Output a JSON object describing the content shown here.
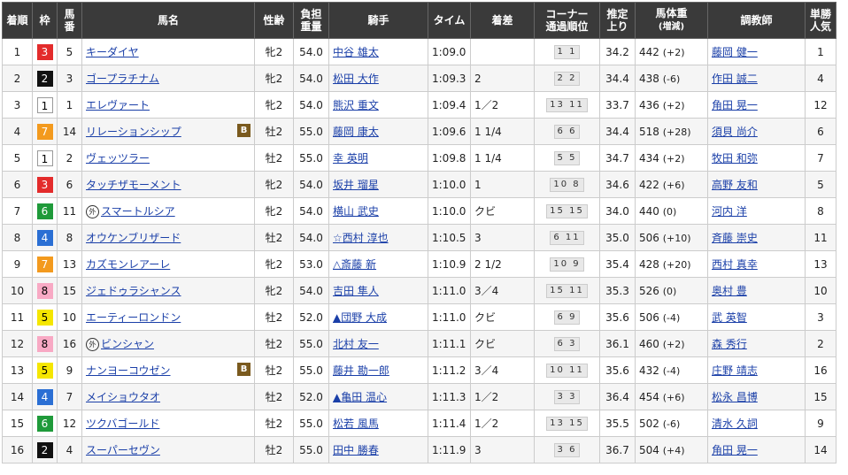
{
  "headers": {
    "rank": [
      "着順"
    ],
    "waku": [
      "枠"
    ],
    "num": [
      "馬",
      "番"
    ],
    "name": [
      "馬名"
    ],
    "sexage": [
      "性齢"
    ],
    "kinryo": [
      "負担",
      "重量"
    ],
    "jockey": [
      "騎手"
    ],
    "time": [
      "タイム"
    ],
    "margin": [
      "着差"
    ],
    "corner": [
      "コーナー",
      "通過順位"
    ],
    "agari": [
      "推定",
      "上り"
    ],
    "weight": [
      "馬体重",
      "(増減)"
    ],
    "trainer": [
      "調教師"
    ],
    "pop": [
      "単勝",
      "人気"
    ]
  },
  "rows": [
    {
      "rank": "1",
      "waku": "3",
      "num": "5",
      "name": "キーダイヤ",
      "gai": "",
      "blinker": "",
      "sex": "牝2",
      "kin": "54.0",
      "jockey": "中谷 雄太",
      "time": "1:09.0",
      "margin": "",
      "corner": "1 1",
      "agari": "34.2",
      "weight": "442",
      "diff": "(+2)",
      "trainer": "藤岡 健一",
      "pop": "1"
    },
    {
      "rank": "2",
      "waku": "2",
      "num": "3",
      "name": "ゴープラチナム",
      "gai": "",
      "blinker": "",
      "sex": "牝2",
      "kin": "54.0",
      "jockey": "松田 大作",
      "time": "1:09.3",
      "margin": "2",
      "corner": "2 2",
      "agari": "34.4",
      "weight": "438",
      "diff": "(-6)",
      "trainer": "作田 誠二",
      "pop": "4"
    },
    {
      "rank": "3",
      "waku": "1",
      "num": "1",
      "name": "エレヴァート",
      "gai": "",
      "blinker": "",
      "sex": "牝2",
      "kin": "54.0",
      "jockey": "熊沢 重文",
      "time": "1:09.4",
      "margin": "1／2",
      "corner": "13 11",
      "agari": "33.7",
      "weight": "436",
      "diff": "(+2)",
      "trainer": "角田 晃一",
      "pop": "12"
    },
    {
      "rank": "4",
      "waku": "7",
      "num": "14",
      "name": "リレーションシップ",
      "gai": "",
      "blinker": "B",
      "sex": "牡2",
      "kin": "55.0",
      "jockey": "藤岡 康太",
      "time": "1:09.6",
      "margin": "1 1/4",
      "corner": "6 6",
      "agari": "34.4",
      "weight": "518",
      "diff": "(+28)",
      "trainer": "須貝 尚介",
      "pop": "6"
    },
    {
      "rank": "5",
      "waku": "1",
      "num": "2",
      "name": "ヴェッツラー",
      "gai": "",
      "blinker": "",
      "sex": "牡2",
      "kin": "55.0",
      "jockey": "幸 英明",
      "time": "1:09.8",
      "margin": "1 1/4",
      "corner": "5 5",
      "agari": "34.7",
      "weight": "434",
      "diff": "(+2)",
      "trainer": "牧田 和弥",
      "pop": "7"
    },
    {
      "rank": "6",
      "waku": "3",
      "num": "6",
      "name": "タッチザモーメント",
      "gai": "",
      "blinker": "",
      "sex": "牝2",
      "kin": "54.0",
      "jockey": "坂井 瑠星",
      "time": "1:10.0",
      "margin": "1",
      "corner": "10 8",
      "agari": "34.6",
      "weight": "422",
      "diff": "(+6)",
      "trainer": "高野 友和",
      "pop": "5"
    },
    {
      "rank": "7",
      "waku": "6",
      "num": "11",
      "name": "スマートルシア",
      "gai": "外",
      "blinker": "",
      "sex": "牝2",
      "kin": "54.0",
      "jockey": "横山 武史",
      "time": "1:10.0",
      "margin": "クビ",
      "corner": "15 15",
      "agari": "34.0",
      "weight": "440",
      "diff": "(0)",
      "trainer": "河内 洋",
      "pop": "8"
    },
    {
      "rank": "8",
      "waku": "4",
      "num": "8",
      "name": "オウケンブリザード",
      "gai": "",
      "blinker": "",
      "sex": "牡2",
      "kin": "54.0",
      "jockey": "☆西村 淳也",
      "time": "1:10.5",
      "margin": "3",
      "corner": "6 11",
      "agari": "35.0",
      "weight": "506",
      "diff": "(+10)",
      "trainer": "斉藤 崇史",
      "pop": "11"
    },
    {
      "rank": "9",
      "waku": "7",
      "num": "13",
      "name": "カズモンレアーレ",
      "gai": "",
      "blinker": "",
      "sex": "牝2",
      "kin": "53.0",
      "jockey": "△斎藤 新",
      "time": "1:10.9",
      "margin": "2 1/2",
      "corner": "10 9",
      "agari": "35.4",
      "weight": "428",
      "diff": "(+20)",
      "trainer": "西村 真幸",
      "pop": "13"
    },
    {
      "rank": "10",
      "waku": "8",
      "num": "15",
      "name": "ジェドゥラシャンス",
      "gai": "",
      "blinker": "",
      "sex": "牝2",
      "kin": "54.0",
      "jockey": "吉田 隼人",
      "time": "1:11.0",
      "margin": "3／4",
      "corner": "15 11",
      "agari": "35.3",
      "weight": "526",
      "diff": "(0)",
      "trainer": "奥村 豊",
      "pop": "10"
    },
    {
      "rank": "11",
      "waku": "5",
      "num": "10",
      "name": "エーティーロンドン",
      "gai": "",
      "blinker": "",
      "sex": "牡2",
      "kin": "52.0",
      "jockey": "▲団野 大成",
      "time": "1:11.0",
      "margin": "クビ",
      "corner": "6 9",
      "agari": "35.6",
      "weight": "506",
      "diff": "(-4)",
      "trainer": "武 英智",
      "pop": "3"
    },
    {
      "rank": "12",
      "waku": "8",
      "num": "16",
      "name": "ビンシャン",
      "gai": "外",
      "blinker": "",
      "sex": "牡2",
      "kin": "55.0",
      "jockey": "北村 友一",
      "time": "1:11.1",
      "margin": "クビ",
      "corner": "6 3",
      "agari": "36.1",
      "weight": "460",
      "diff": "(+2)",
      "trainer": "森 秀行",
      "pop": "2"
    },
    {
      "rank": "13",
      "waku": "5",
      "num": "9",
      "name": "ナンヨーコウゼン",
      "gai": "",
      "blinker": "B",
      "sex": "牡2",
      "kin": "55.0",
      "jockey": "藤井 勘一郎",
      "time": "1:11.2",
      "margin": "3／4",
      "corner": "10 11",
      "agari": "35.6",
      "weight": "432",
      "diff": "(-4)",
      "trainer": "庄野 靖志",
      "pop": "16"
    },
    {
      "rank": "14",
      "waku": "4",
      "num": "7",
      "name": "メイショウタオ",
      "gai": "",
      "blinker": "",
      "sex": "牡2",
      "kin": "52.0",
      "jockey": "▲亀田 温心",
      "time": "1:11.3",
      "margin": "1／2",
      "corner": "3 3",
      "agari": "36.4",
      "weight": "454",
      "diff": "(+6)",
      "trainer": "松永 昌博",
      "pop": "15"
    },
    {
      "rank": "15",
      "waku": "6",
      "num": "12",
      "name": "ツクバゴールド",
      "gai": "",
      "blinker": "",
      "sex": "牡2",
      "kin": "55.0",
      "jockey": "松若 風馬",
      "time": "1:11.4",
      "margin": "1／2",
      "corner": "13 15",
      "agari": "35.5",
      "weight": "502",
      "diff": "(-6)",
      "trainer": "清水 久詞",
      "pop": "9"
    },
    {
      "rank": "16",
      "waku": "2",
      "num": "4",
      "name": "スーパーセヴン",
      "gai": "",
      "blinker": "",
      "sex": "牡2",
      "kin": "55.0",
      "jockey": "田中 勝春",
      "time": "1:11.9",
      "margin": "3",
      "corner": "3 6",
      "agari": "36.7",
      "weight": "504",
      "diff": "(+4)",
      "trainer": "角田 晃一",
      "pop": "14"
    }
  ]
}
